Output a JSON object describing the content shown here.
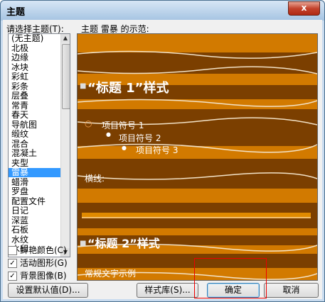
{
  "window": {
    "title": "主题",
    "close_label": "x"
  },
  "list_label": "请选择主题(T):",
  "preview_label": "主题 雷暴 的示范:",
  "themes": [
    "(无主题)",
    "北极",
    "边缘",
    "冰块",
    "彩虹",
    "彩条",
    "层叠",
    "常青",
    "春天",
    "导航图",
    "缎纹",
    "混合",
    "混凝土",
    "夹型",
    "雷暴",
    "蜡滑",
    "罗盘",
    "配置文件",
    "日记",
    "深蓝",
    "石板",
    "水纹",
    "水印"
  ],
  "selected_theme": "雷暴",
  "options": [
    {
      "label": "鲜艳颜色(C)",
      "checked": false
    },
    {
      "label": "活动图形(G)",
      "checked": true
    },
    {
      "label": "背景图像(B)",
      "checked": true
    }
  ],
  "preview": {
    "heading1": "“标题 1”样式",
    "bullets": [
      "项目符号 1",
      "项目符号 2",
      "项目符号 3"
    ],
    "hline_label": "横线:",
    "heading2": "“标题 2”样式",
    "normal_text": "常规文字示例"
  },
  "buttons": {
    "set_default": "设置默认值(D)...",
    "style_gallery": "样式库(S)...",
    "ok": "确定",
    "cancel": "取消"
  },
  "colors": {
    "preview_bg": "#7b3f00",
    "band": "#d27a00",
    "selection": "#3399ff"
  }
}
